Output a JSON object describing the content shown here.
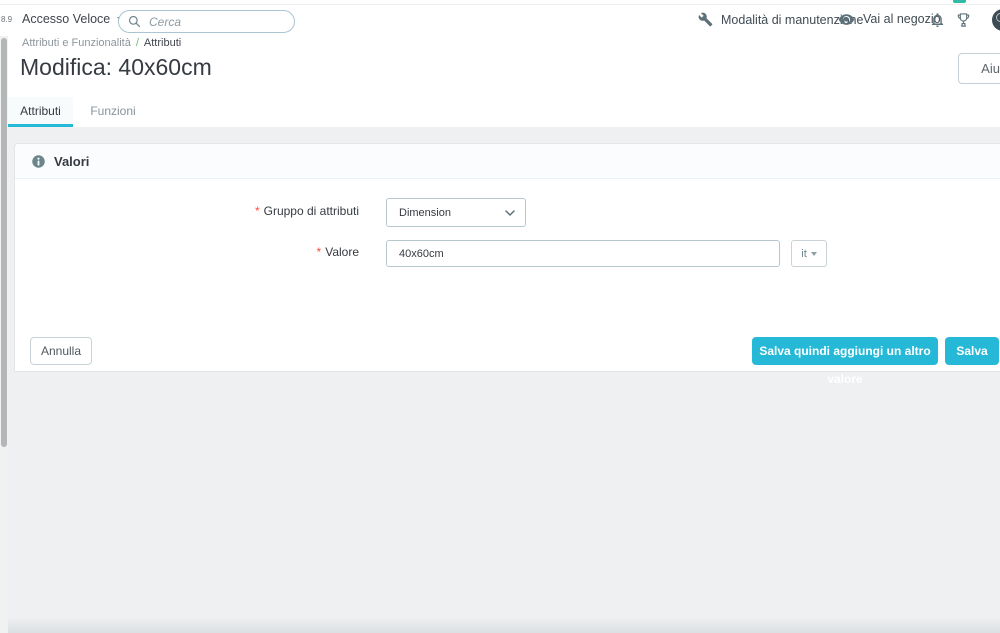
{
  "header": {
    "version_fragment": "8.9",
    "quick_access_label": "Accesso Veloce",
    "search_placeholder": "Cerca",
    "maintenance_label": "Modalità di manutenzione",
    "view_shop_label": "Vai al negozio"
  },
  "breadcrumb": {
    "parent": "Attributi e Funzionalità",
    "separator": "/",
    "current": "Attributi"
  },
  "page": {
    "title": "Modifica: 40x60cm",
    "help_label": "Aiuto"
  },
  "tabs": [
    {
      "label": "Attributi",
      "active": true
    },
    {
      "label": "Funzioni",
      "active": false
    }
  ],
  "panel": {
    "title": "Valori",
    "required_mark": "*",
    "fields": [
      {
        "label": "Gruppo di attributi",
        "required": true,
        "type": "select",
        "value": "Dimension"
      },
      {
        "label": "Valore",
        "required": true,
        "type": "text",
        "value": "40x60cm",
        "lang": "it"
      }
    ],
    "cancel_label": "Annulla",
    "save_add_label": "Salva quindi aggiungi un altro valore",
    "save_label": "Salva"
  },
  "icons": {
    "search": "magnifier",
    "maintenance": "wrench",
    "view_shop": "eye",
    "notifications": "bell",
    "achievements": "trophy",
    "panel_info": "info-circle",
    "select": "chevron-down",
    "dropdowns": "caret-down"
  },
  "colors": {
    "accent": "#25b9d7",
    "required": "#f54c3e",
    "breadcrumb_separator": "#6fbe73",
    "top_indicator": "#2ebca4",
    "background": "#eef0f1",
    "icon_gray": "#5e717b"
  }
}
